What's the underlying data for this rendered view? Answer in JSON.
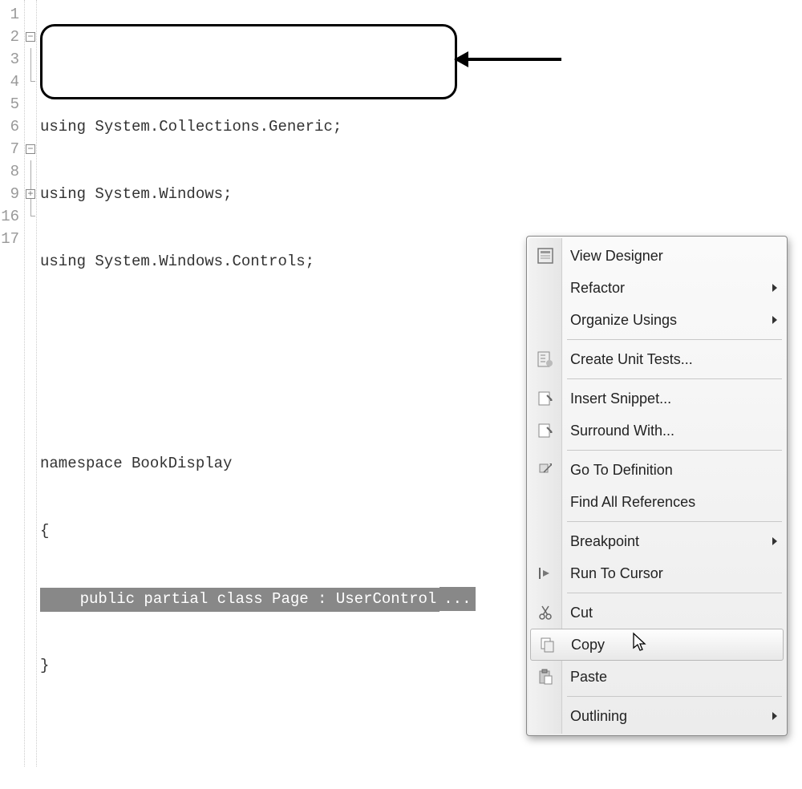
{
  "editor": {
    "line_numbers": [
      "1",
      "2",
      "3",
      "4",
      "5",
      "6",
      "7",
      "8",
      "9",
      "16",
      "17"
    ],
    "fold_markers": {
      "line2": "−",
      "line7": "−",
      "line9": "+"
    },
    "lines": [
      "",
      "using System.Collections.Generic;",
      "using System.Windows;",
      "using System.Windows.Controls;",
      "",
      "",
      "namespace BookDisplay",
      "{",
      "    public partial class Page : UserControl",
      "}",
      ""
    ],
    "collapsed_suffix": "..."
  },
  "context_menu": {
    "items": [
      {
        "label": "View Designer",
        "icon": "designer-icon",
        "submenu": false,
        "separator_after": false
      },
      {
        "label": "Refactor",
        "icon": null,
        "submenu": true,
        "separator_after": false
      },
      {
        "label": "Organize Usings",
        "icon": null,
        "submenu": true,
        "separator_after": true
      },
      {
        "label": "Create Unit Tests...",
        "icon": "unit-test-icon",
        "submenu": false,
        "separator_after": true
      },
      {
        "label": "Insert Snippet...",
        "icon": "snippet-icon",
        "submenu": false,
        "separator_after": false
      },
      {
        "label": "Surround With...",
        "icon": "surround-icon",
        "submenu": false,
        "separator_after": true
      },
      {
        "label": "Go To Definition",
        "icon": "goto-def-icon",
        "submenu": false,
        "separator_after": false
      },
      {
        "label": "Find All References",
        "icon": null,
        "submenu": false,
        "separator_after": true
      },
      {
        "label": "Breakpoint",
        "icon": null,
        "submenu": true,
        "separator_after": false
      },
      {
        "label": "Run To Cursor",
        "icon": "run-cursor-icon",
        "submenu": false,
        "separator_after": true
      },
      {
        "label": "Cut",
        "icon": "cut-icon",
        "submenu": false,
        "separator_after": false
      },
      {
        "label": "Copy",
        "icon": "copy-icon",
        "submenu": false,
        "separator_after": false,
        "hover": true
      },
      {
        "label": "Paste",
        "icon": "paste-icon",
        "submenu": false,
        "separator_after": true
      },
      {
        "label": "Outlining",
        "icon": null,
        "submenu": true,
        "separator_after": false
      }
    ]
  }
}
